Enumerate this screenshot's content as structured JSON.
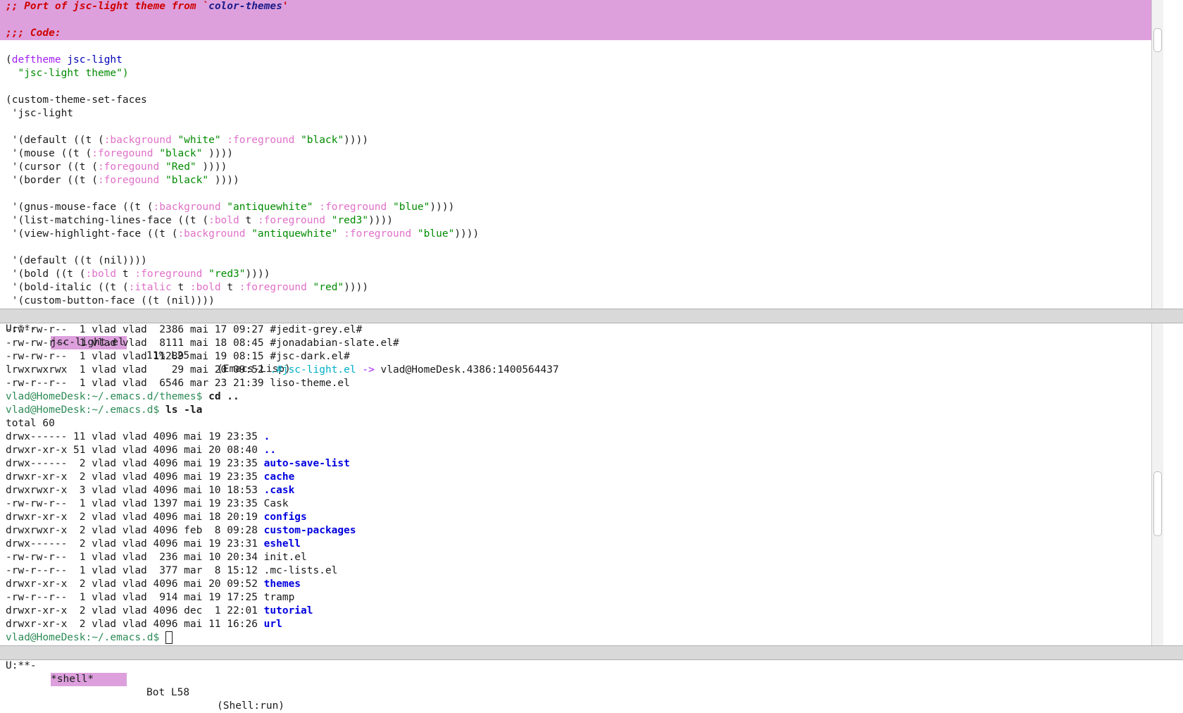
{
  "editor": {
    "header_lines": [
      {
        "cmt1": ";; Port of jsc-light theme from `",
        "cmt2": "color-themes",
        "cmt3": "'"
      },
      {
        "cmt1": ";;; Code:"
      }
    ],
    "deftheme": {
      "open": "(",
      "kw": "deftheme",
      "name": "jsc-light"
    },
    "deftheme_doc": "\"jsc-light theme\")",
    "cts": "(custom-theme-set-faces",
    "cts_name": " 'jsc-light",
    "faces": [
      {
        "p1": " '(default ((t (",
        "k1": ":background",
        "s1": "\"white\"",
        "k2": ":foreground",
        "s2": "\"black\"",
        "end": "))))"
      },
      {
        "p1": " '(mouse ((t (",
        "k1": ":foregound",
        "s1": "\"black\"",
        "end": "))))"
      },
      {
        "p1": " '(cursor ((t (",
        "k1": ":foregound",
        "s1": "\"Red\"",
        "end": "))))"
      },
      {
        "p1": " '(border ((t (",
        "k1": ":foregound",
        "s1": "\"black\"",
        "end": "))))"
      },
      {
        "blank": true
      },
      {
        "p1": " '(gnus-mouse-face ((t (",
        "k1": ":background",
        "s1": "\"antiquewhite\"",
        "k2": ":foreground",
        "s2": "\"blue\"",
        "end": "))))"
      },
      {
        "p1": " '(list-matching-lines-face ((t (",
        "k1": ":bold",
        "mid": "t",
        "k2": ":foreground",
        "s2": "\"red3\"",
        "end": "))))"
      },
      {
        "p1": " '(view-highlight-face ((t (",
        "k1": ":background",
        "s1": "\"antiquewhite\"",
        "k2": ":foreground",
        "s2": "\"blue\"",
        "end": "))))"
      },
      {
        "blank": true
      },
      {
        "p1": " '(default ((t (nil))))"
      },
      {
        "p1": " '(bold ((t (",
        "k1": ":bold",
        "mid": "t",
        "k2": ":foreground",
        "s2": "\"red3\"",
        "end": "))))"
      },
      {
        "p1": " '(bold-italic ((t (",
        "k1": ":italic",
        "mid": "t",
        "k2": ":bold",
        "mid2": "t",
        "k3": ":foreground",
        "s3": "\"red\"",
        "end": "))))"
      },
      {
        "p1": " '(custom-button-face ((t (nil))))"
      }
    ],
    "modeline": {
      "state": "U:**-",
      "buffer": "jsc-light.el",
      "position": "11% L25",
      "mode": "(Emacs-Lisp)"
    }
  },
  "shell": {
    "top_listing": [
      {
        "meta": "-rw-rw-r--  1 vlad vlad  2386 mai 17 09:27 ",
        "name": "#jedit-grey.el#"
      },
      {
        "meta": "-rw-rw-r--  1 vlad vlad  8111 mai 18 08:45 ",
        "name": "#jonadabian-slate.el#"
      },
      {
        "meta": "-rw-rw-r--  1 vlad vlad 11289 mai 19 08:15 ",
        "name": "#jsc-dark.el#"
      },
      {
        "meta": "lrwxrwxrwx  1 vlad vlad    29 mai 20 09:52 ",
        "link_name": ".#jsc-light.el",
        "arrow": "->",
        "target": "vlad@HomeDesk.4386:1400564437"
      },
      {
        "meta": "-rw-r--r--  1 vlad vlad  6546 mar 23 21:39 ",
        "name": "liso-theme.el"
      }
    ],
    "cmd1": {
      "prompt": "vlad@HomeDesk:~/.emacs.d/themes$ ",
      "command": "cd .."
    },
    "cmd2": {
      "prompt": "vlad@HomeDesk:~/.emacs.d$ ",
      "command": "ls -la"
    },
    "total": "total 60",
    "listing": [
      {
        "meta": "drwx------ 11 vlad vlad 4096 mai 19 23:35 ",
        "name": ".",
        "dir": true
      },
      {
        "meta": "drwxr-xr-x 51 vlad vlad 4096 mai 20 08:40 ",
        "name": "..",
        "dir": true
      },
      {
        "meta": "drwx------  2 vlad vlad 4096 mai 19 23:35 ",
        "name": "auto-save-list",
        "dir": true
      },
      {
        "meta": "drwxr-xr-x  2 vlad vlad 4096 mai 19 23:35 ",
        "name": "cache",
        "dir": true
      },
      {
        "meta": "drwxrwxr-x  3 vlad vlad 4096 mai 10 18:53 ",
        "name": ".cask",
        "dir": true
      },
      {
        "meta": "-rw-rw-r--  1 vlad vlad 1397 mai 19 23:35 ",
        "name": "Cask",
        "dir": false
      },
      {
        "meta": "drwxr-xr-x  2 vlad vlad 4096 mai 18 20:19 ",
        "name": "configs",
        "dir": true
      },
      {
        "meta": "drwxrwxr-x  2 vlad vlad 4096 feb  8 09:28 ",
        "name": "custom-packages",
        "dir": true
      },
      {
        "meta": "drwx------  2 vlad vlad 4096 mai 19 23:31 ",
        "name": "eshell",
        "dir": true
      },
      {
        "meta": "-rw-rw-r--  1 vlad vlad  236 mai 10 20:34 ",
        "name": "init.el",
        "dir": false
      },
      {
        "meta": "-rw-r--r--  1 vlad vlad  377 mar  8 15:12 ",
        "name": ".mc-lists.el",
        "dir": false
      },
      {
        "meta": "drwxr-xr-x  2 vlad vlad 4096 mai 20 09:52 ",
        "name": "themes",
        "dir": true
      },
      {
        "meta": "-rw-r--r--  1 vlad vlad  914 mai 19 17:25 ",
        "name": "tramp",
        "dir": false
      },
      {
        "meta": "drwxr-xr-x  2 vlad vlad 4096 dec  1 22:01 ",
        "name": "tutorial",
        "dir": true
      },
      {
        "meta": "drwxr-xr-x  2 vlad vlad 4096 mai 11 16:26 ",
        "name": "url",
        "dir": true
      }
    ],
    "final_prompt": "vlad@HomeDesk:~/.emacs.d$ ",
    "modeline": {
      "state": "U:**-",
      "buffer": "*shell*",
      "position": "Bot L58",
      "mode": "(Shell:run)"
    }
  },
  "colors": {
    "highlight": "#dda0dd",
    "comment": "#d00000",
    "keyword": "#a020f0",
    "string": "#008b00",
    "keyword_arg": "#e070c8",
    "prompt": "#2e8b57",
    "directory": "#0000e0"
  }
}
